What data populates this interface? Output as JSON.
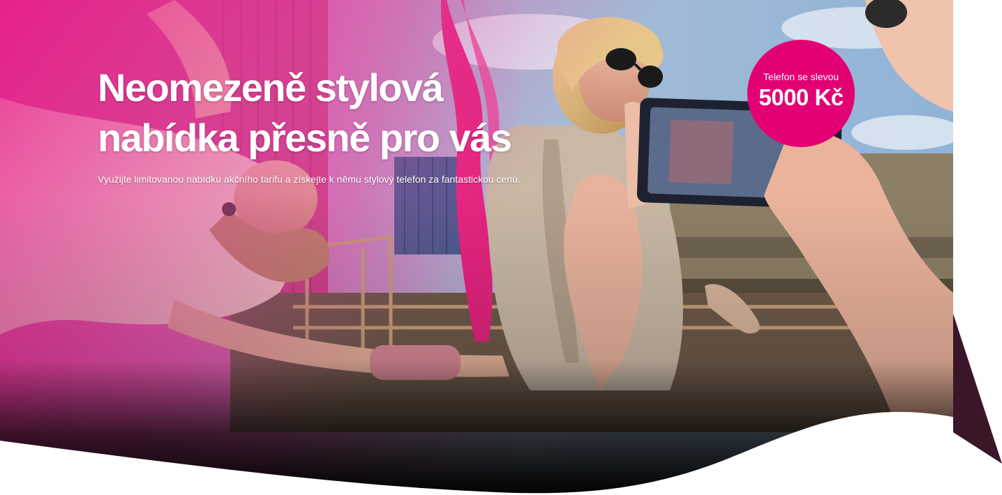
{
  "hero": {
    "title_line_1": "Neomezeně stylová",
    "title_line_2": "nabídka přesně pro vás",
    "subtitle": "Využijte limitovanou nabídku akčního tarifu a získejte k němu stylový telefon za fantastickou cenu.",
    "background_image": "photo-woman-taking-smartphone-photo-of-friend-with-pink-scarf"
  },
  "badge": {
    "caption": "Telefon se slevou",
    "amount": "5000 Kč"
  },
  "colors": {
    "brand_magenta": "#e20074",
    "text": "#ffffff",
    "dark_plum": "#3b1528",
    "page_background": "#ffffff"
  }
}
